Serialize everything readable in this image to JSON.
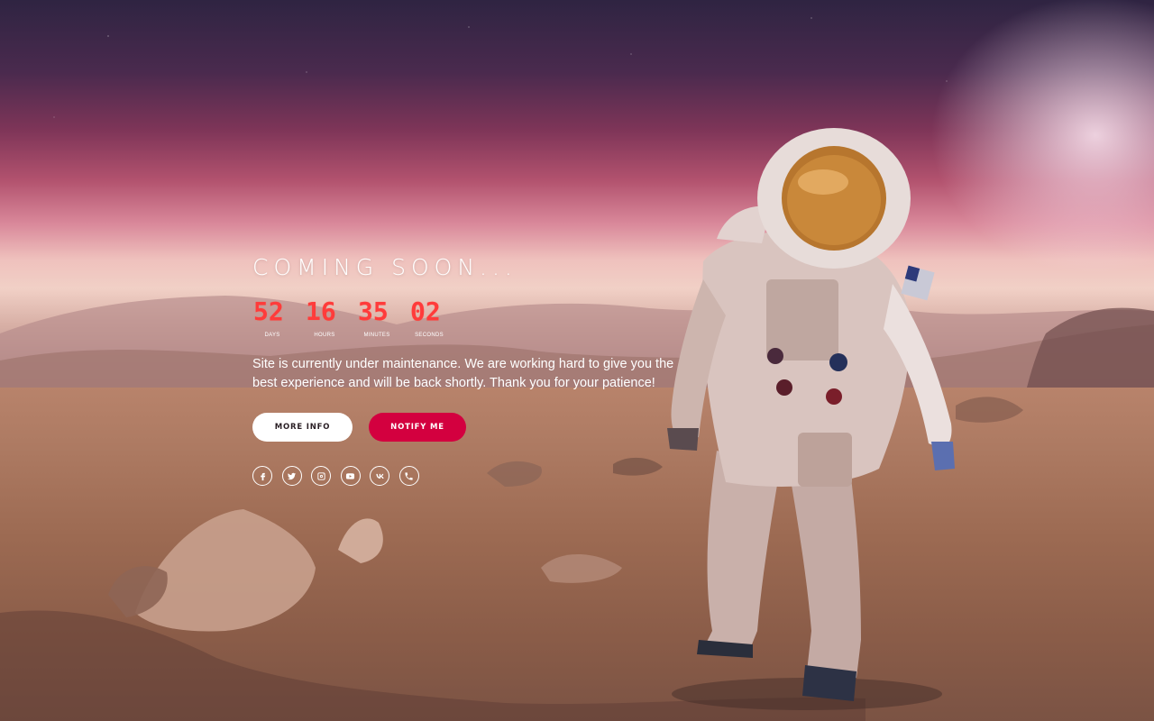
{
  "page": {
    "title": "COMING SOON..."
  },
  "countdown": [
    {
      "value": "52",
      "label": "DAYS"
    },
    {
      "value": "16",
      "label": "HOURS"
    },
    {
      "value": "35",
      "label": "MINUTES"
    },
    {
      "value": "02",
      "label": "SECONDS"
    }
  ],
  "description": "Site is currently under maintenance. We are working hard to give you the best experience and will be back shortly. Thank you for your patience!",
  "buttons": {
    "more_info": "MORE INFO",
    "notify_me": "NOTIFY ME"
  },
  "socials": [
    {
      "icon": "facebook-icon"
    },
    {
      "icon": "twitter-icon"
    },
    {
      "icon": "instagram-icon"
    },
    {
      "icon": "youtube-icon"
    },
    {
      "icon": "vk-icon"
    },
    {
      "icon": "phone-icon"
    }
  ],
  "colors": {
    "accent": "#d3003f",
    "countdown_digits": "#ff3b3b",
    "text": "#ffffff"
  }
}
